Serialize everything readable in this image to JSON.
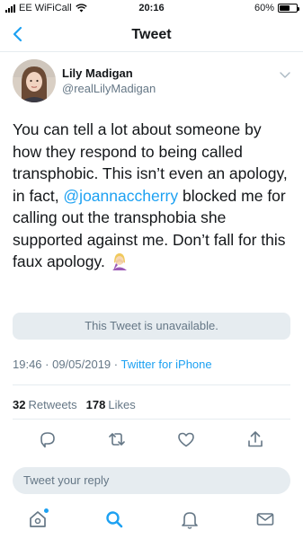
{
  "status_bar": {
    "carrier": "EE WiFiCall",
    "time": "20:16",
    "battery": "60%"
  },
  "nav": {
    "title": "Tweet",
    "back_icon": "chevron-left-icon"
  },
  "tweet": {
    "author_name": "Lily Madigan",
    "author_handle": "@realLilyMadigan",
    "text_1": "You can tell a lot about someone by how they respond to being called transphobic. This isn’t even an apology, in fact, ",
    "mention": "@joannaccherry",
    "text_2": " blocked me for calling out the transphobia she supported against me. Don’t fall for this faux apology. ",
    "emoji": "woman-facepalming-emoji",
    "quoted_notice": "This Tweet is unavailable.",
    "timestamp": "19:46 · 09/05/2019 · ",
    "source": "Twitter for iPhone",
    "retweets_count": "32",
    "retweets_label": "Retweets",
    "likes_count": "178",
    "likes_label": "Likes"
  },
  "actions": [
    "reply-icon",
    "retweet-icon",
    "like-icon",
    "share-icon"
  ],
  "reply": {
    "placeholder": "Tweet your reply"
  },
  "tabs": [
    "home-icon",
    "search-icon",
    "notifications-icon",
    "messages-icon"
  ],
  "colors": {
    "accent": "#1da1f2",
    "muted": "#657786",
    "text": "#14171a",
    "surface": "#e6ecf0"
  }
}
